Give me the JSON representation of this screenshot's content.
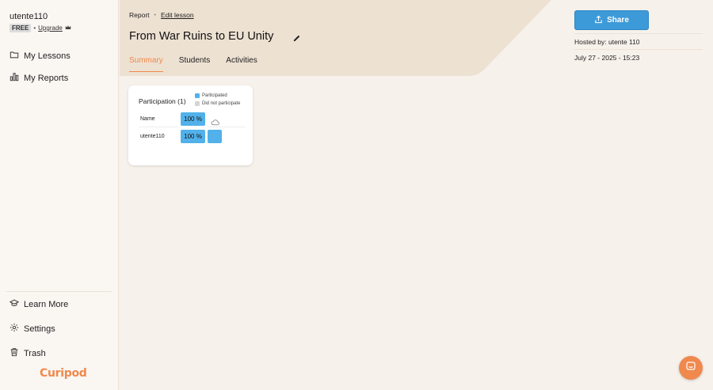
{
  "user": {
    "name": "utente110",
    "plan": "FREE",
    "upgrade_label": "Upgrade"
  },
  "sidebar": {
    "top_items": [
      {
        "label": "My Lessons",
        "icon": "folder-icon"
      },
      {
        "label": "My Reports",
        "icon": "bar-chart-icon"
      }
    ],
    "bottom_items": [
      {
        "label": "Learn More",
        "icon": "graduation-cap-icon"
      },
      {
        "label": "Settings",
        "icon": "gear-icon"
      },
      {
        "label": "Trash",
        "icon": "trash-icon"
      }
    ],
    "logo": "Curipod"
  },
  "breadcrumb": {
    "current": "Report",
    "link": "Edit lesson"
  },
  "lesson": {
    "title": "From War Ruins to EU Unity"
  },
  "tabs": [
    {
      "label": "Summary",
      "active": true
    },
    {
      "label": "Students",
      "active": false
    },
    {
      "label": "Activities",
      "active": false
    }
  ],
  "share": {
    "label": "Share"
  },
  "meta": {
    "hosted_by": "Hosted by: utente 110",
    "datetime": "July 27 - 2025 - 15:23"
  },
  "participation": {
    "title": "Participation (1)",
    "legend": [
      {
        "label": "Participated",
        "color": "#52b1ea"
      },
      {
        "label": "Did not participate",
        "color": "#d4d4d4"
      }
    ],
    "header": {
      "name_label": "Name",
      "summary_value": "100 %"
    },
    "rows": [
      {
        "name": "utente110",
        "value": "100 %",
        "participated": true
      }
    ]
  },
  "colors": {
    "accent": "#f0894d",
    "primary": "#3d9ad9",
    "participated": "#52b1ea"
  }
}
